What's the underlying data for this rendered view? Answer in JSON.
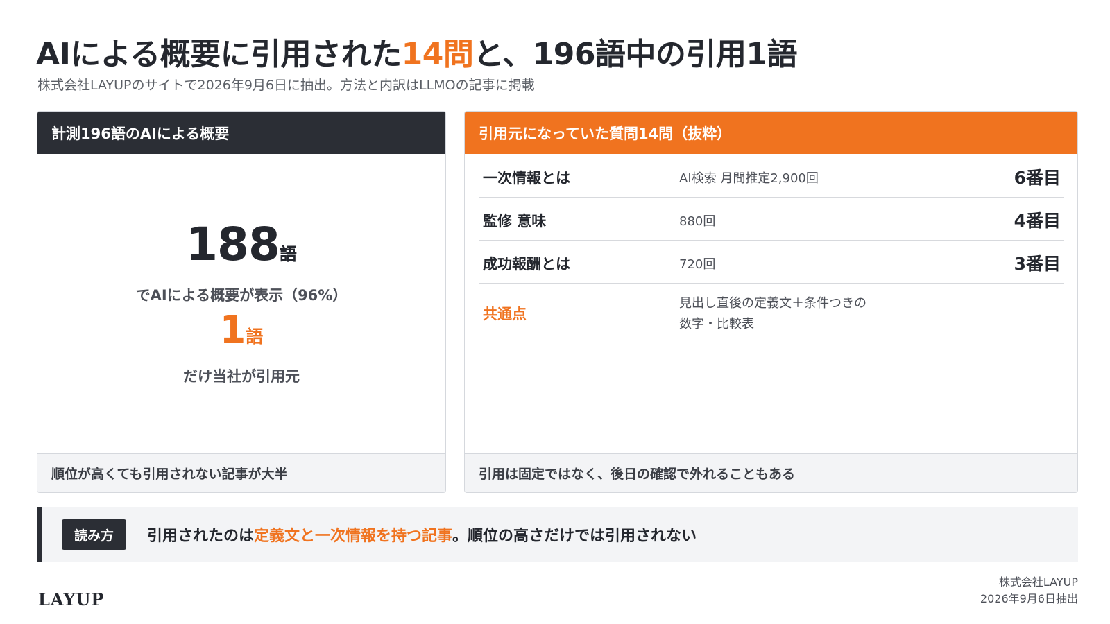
{
  "header": {
    "title_part1": "AIによる概要に引用された",
    "title_accent": "14問",
    "title_part2": "と、196語中の引用1語",
    "subtitle": "株式会社LAYUPのサイトで2026年9月6日に抽出。方法と内訳はLLMOの記事に掲載"
  },
  "left_card": {
    "heading": "計測196語のAIによる概要",
    "big_number": "188",
    "big_unit": "語",
    "big_text": "でAIによる概要が表示（96%）",
    "cited_number": "1",
    "cited_unit": "語",
    "cited_text": "だけ当社が引用元",
    "footer": "順位が高くても引用されない記事が大半"
  },
  "right_card": {
    "heading": "引用元になっていた質問14問（抜粋）",
    "rows": [
      {
        "keyword": "一次情報とは",
        "volume": "AI検索 月間推定2,900回",
        "rank": "6番目"
      },
      {
        "keyword": "監修 意味",
        "volume": "880回",
        "rank": "4番目"
      },
      {
        "keyword": "成功報酬とは",
        "volume": "720回",
        "rank": "3番目"
      }
    ],
    "common": {
      "label": "共通点",
      "line1": "見出し直後の定義文＋条件つきの",
      "line2": "数字・比較表"
    },
    "footer": "引用は固定ではなく、後日の確認で外れることもある"
  },
  "reading": {
    "badge": "読み方",
    "text_part1": "引用されたのは",
    "text_accent": "定義文と一次情報を持つ記事",
    "text_part2": "。順位の高さだけでは引用されない"
  },
  "footer": {
    "logo": "LAYUP",
    "company": "株式会社LAYUP",
    "date": "2026年9月6日抽出"
  },
  "colors": {
    "accent": "#f0731f",
    "dark": "#2b2e35"
  }
}
